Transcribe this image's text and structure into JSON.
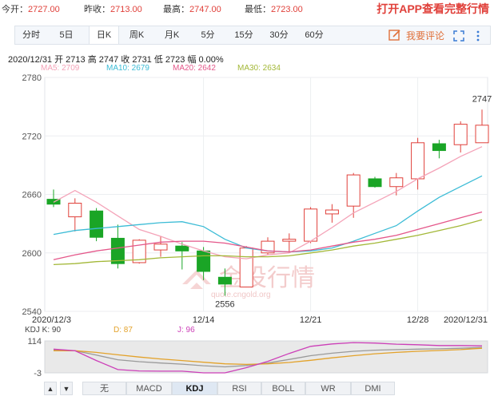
{
  "quote": {
    "open_label": "今开：",
    "open_value": "2727.00",
    "prev_label": "昨收：",
    "prev_value": "2713.00",
    "high_label": "最高：",
    "high_value": "2747.00",
    "low_label": "最低：",
    "low_value": "2723.00",
    "app_cta": "打开APP查看完整行情"
  },
  "tabs": [
    {
      "label": "分时"
    },
    {
      "label": "5日"
    },
    {
      "label": "日K",
      "active": true
    },
    {
      "label": "周K"
    },
    {
      "label": "月K"
    },
    {
      "label": "5分"
    },
    {
      "label": "15分"
    },
    {
      "label": "30分"
    },
    {
      "label": "60分"
    }
  ],
  "comment_label": "我要评论",
  "info_line": "2020/12/31  开 2713  高 2747  收 2731  低 2723  幅 0.00%",
  "ma_legend": [
    {
      "label": "MA5: 2709",
      "color": "#f4a3b8"
    },
    {
      "label": "MA10: 2679",
      "color": "#3cbcd6"
    },
    {
      "label": "MA20: 2642",
      "color": "#e4578a"
    },
    {
      "label": "MA30: 2634",
      "color": "#a3b838"
    }
  ],
  "watermark": "金投行情",
  "watermark_sub": "quote.cngold.org",
  "kdj_legend": [
    {
      "label": "KDJ  K: 90",
      "color": "#444"
    },
    {
      "label": "D: 87",
      "color": "#e3a22a"
    },
    {
      "label": "J: 96",
      "color": "#cc3fb8"
    }
  ],
  "indicators": [
    {
      "label": "无"
    },
    {
      "label": "MACD"
    },
    {
      "label": "KDJ",
      "active": true
    },
    {
      "label": "RSI"
    },
    {
      "label": "BOLL"
    },
    {
      "label": "WR"
    },
    {
      "label": "DMI"
    }
  ],
  "nav": {
    "up": "▲",
    "down": "▼"
  },
  "chart_data": {
    "type": "candlestick",
    "y_ticks": [
      2780,
      2720,
      2660,
      2600,
      2540
    ],
    "ylim": [
      2540,
      2780
    ],
    "x_tick_labels": [
      {
        "index": 0,
        "label": "2020/12/3"
      },
      {
        "index": 7,
        "label": "12/14"
      },
      {
        "index": 12,
        "label": "12/21"
      },
      {
        "index": 17,
        "label": "12/28"
      },
      {
        "index": 20,
        "label": "2020/12/31"
      }
    ],
    "annotations": [
      {
        "index": 20,
        "value": 2747,
        "label": "2747",
        "pos": "above"
      },
      {
        "index": 8,
        "value": 2556,
        "label": "2556",
        "pos": "below"
      }
    ],
    "up_color": "#e0403a",
    "down_color": "#1aa526",
    "candles": [
      {
        "o": 2655,
        "h": 2665,
        "l": 2647,
        "c": 2650
      },
      {
        "o": 2637,
        "h": 2656,
        "l": 2622,
        "c": 2651
      },
      {
        "o": 2643,
        "h": 2646,
        "l": 2612,
        "c": 2616
      },
      {
        "o": 2615,
        "h": 2629,
        "l": 2584,
        "c": 2589
      },
      {
        "o": 2590,
        "h": 2614,
        "l": 2589,
        "c": 2613
      },
      {
        "o": 2603,
        "h": 2617,
        "l": 2596,
        "c": 2609
      },
      {
        "o": 2607,
        "h": 2611,
        "l": 2583,
        "c": 2602
      },
      {
        "o": 2602,
        "h": 2606,
        "l": 2572,
        "c": 2581
      },
      {
        "o": 2575,
        "h": 2584,
        "l": 2556,
        "c": 2568
      },
      {
        "o": 2565,
        "h": 2607,
        "l": 2565,
        "c": 2605
      },
      {
        "o": 2600,
        "h": 2616,
        "l": 2598,
        "c": 2612
      },
      {
        "o": 2612,
        "h": 2620,
        "l": 2600,
        "c": 2614
      },
      {
        "o": 2612,
        "h": 2647,
        "l": 2610,
        "c": 2645
      },
      {
        "o": 2640,
        "h": 2650,
        "l": 2631,
        "c": 2644
      },
      {
        "o": 2648,
        "h": 2682,
        "l": 2636,
        "c": 2680
      },
      {
        "o": 2676,
        "h": 2678,
        "l": 2667,
        "c": 2668
      },
      {
        "o": 2668,
        "h": 2682,
        "l": 2659,
        "c": 2677
      },
      {
        "o": 2676,
        "h": 2718,
        "l": 2665,
        "c": 2713
      },
      {
        "o": 2712,
        "h": 2716,
        "l": 2697,
        "c": 2705
      },
      {
        "o": 2711,
        "h": 2735,
        "l": 2703,
        "c": 2732
      },
      {
        "o": 2713,
        "h": 2747,
        "l": 2713,
        "c": 2731
      }
    ],
    "ma": [
      {
        "name": "MA5",
        "color": "#f4a3b8",
        "values": [
          2652,
          2664,
          2652,
          2638,
          2624,
          2617,
          2609,
          2602,
          2596,
          2594,
          2598,
          2600,
          2612,
          2626,
          2641,
          2652,
          2663,
          2676,
          2687,
          2699,
          2709
        ]
      },
      {
        "name": "MA10",
        "color": "#3cbcd6",
        "values": [
          2619,
          2623,
          2625,
          2627,
          2629,
          2631,
          2632,
          2627,
          2614,
          2605,
          2602,
          2601,
          2602,
          2605,
          2612,
          2620,
          2628,
          2643,
          2657,
          2668,
          2679
        ]
      },
      {
        "name": "MA20",
        "color": "#e4578a",
        "values": [
          2593,
          2598,
          2602,
          2605,
          2608,
          2611,
          2612,
          2612,
          2610,
          2606,
          2602,
          2601,
          2603,
          2607,
          2611,
          2614,
          2618,
          2624,
          2630,
          2636,
          2642
        ]
      },
      {
        "name": "MA30",
        "color": "#a3b838",
        "values": [
          2588,
          2589,
          2591,
          2592,
          2593,
          2595,
          2596,
          2597,
          2597,
          2596,
          2596,
          2597,
          2600,
          2603,
          2607,
          2610,
          2614,
          2618,
          2623,
          2628,
          2634
        ]
      }
    ],
    "kdj": {
      "ylim": [
        -3,
        114
      ],
      "y_ticks": [
        114,
        -3
      ],
      "K": [
        80,
        78,
        62,
        45,
        38,
        33,
        29,
        23,
        19,
        24,
        33,
        46,
        60,
        69,
        76,
        80,
        82,
        84,
        85,
        87,
        90
      ],
      "D": [
        78,
        78,
        72,
        63,
        55,
        48,
        42,
        36,
        30,
        28,
        30,
        35,
        43,
        52,
        60,
        67,
        72,
        76,
        79,
        82,
        87
      ],
      "J": [
        84,
        78,
        42,
        9,
        4,
        3,
        3,
        -3,
        -3,
        16,
        39,
        68,
        94,
        103,
        108,
        106,
        102,
        100,
        97,
        97,
        96
      ]
    }
  }
}
